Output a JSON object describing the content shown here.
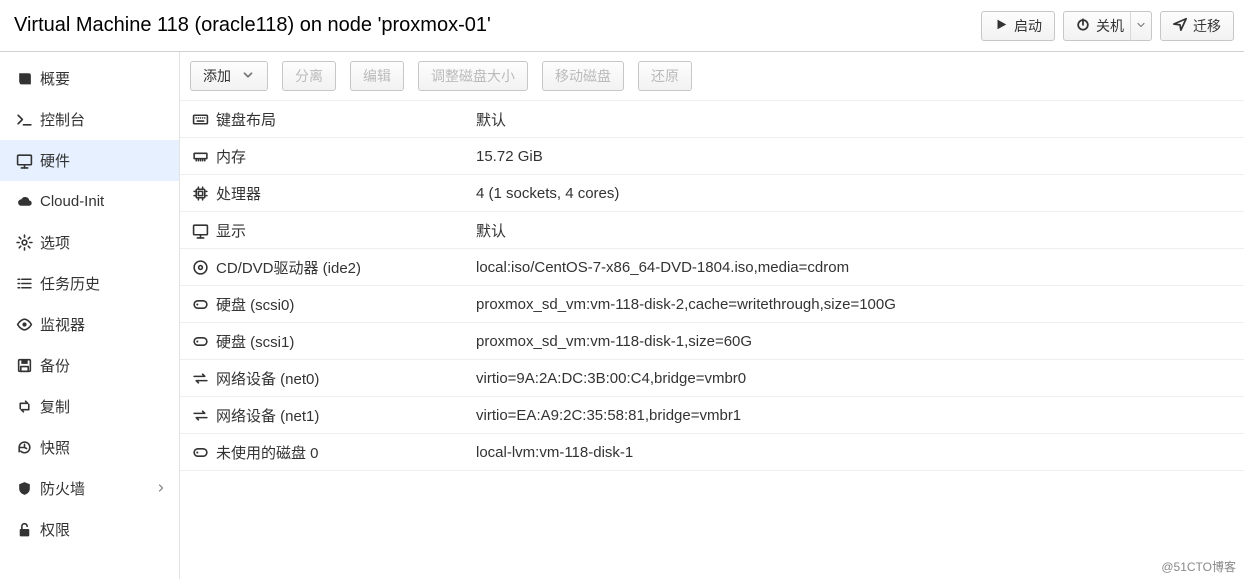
{
  "title": "Virtual Machine 118 (oracle118) on node 'proxmox-01'",
  "header_buttons": {
    "start": "启动",
    "shutdown": "关机",
    "migrate": "迁移"
  },
  "sidebar": {
    "items": [
      {
        "key": "summary",
        "label": "概要"
      },
      {
        "key": "console",
        "label": "控制台"
      },
      {
        "key": "hardware",
        "label": "硬件"
      },
      {
        "key": "cloudinit",
        "label": "Cloud-Init"
      },
      {
        "key": "options",
        "label": "选项"
      },
      {
        "key": "taskhistory",
        "label": "任务历史"
      },
      {
        "key": "monitor",
        "label": "监视器"
      },
      {
        "key": "backup",
        "label": "备份"
      },
      {
        "key": "replication",
        "label": "复制"
      },
      {
        "key": "snapshot",
        "label": "快照"
      },
      {
        "key": "firewall",
        "label": "防火墙",
        "expandable": true
      },
      {
        "key": "permissions",
        "label": "权限"
      }
    ],
    "selected": "hardware"
  },
  "toolbar": {
    "add": "添加",
    "detach": "分离",
    "edit": "编辑",
    "resize": "调整磁盘大小",
    "move": "移动磁盘",
    "revert": "还原"
  },
  "rows": [
    {
      "icon": "keyboard",
      "name": "键盘布局",
      "value": "默认"
    },
    {
      "icon": "memory",
      "name": "内存",
      "value": "15.72 GiB"
    },
    {
      "icon": "cpu",
      "name": "处理器",
      "value": "4 (1 sockets, 4 cores)"
    },
    {
      "icon": "display",
      "name": "显示",
      "value": "默认"
    },
    {
      "icon": "disc",
      "name": "CD/DVD驱动器 (ide2)",
      "value": "local:iso/CentOS-7-x86_64-DVD-1804.iso,media=cdrom"
    },
    {
      "icon": "hdd",
      "name": "硬盘 (scsi0)",
      "value": "proxmox_sd_vm:vm-118-disk-2,cache=writethrough,size=100G"
    },
    {
      "icon": "hdd",
      "name": "硬盘 (scsi1)",
      "value": "proxmox_sd_vm:vm-118-disk-1,size=60G"
    },
    {
      "icon": "net",
      "name": "网络设备 (net0)",
      "value": "virtio=9A:2A:DC:3B:00:C4,bridge=vmbr0"
    },
    {
      "icon": "net",
      "name": "网络设备 (net1)",
      "value": "virtio=EA:A9:2C:35:58:81,bridge=vmbr1"
    },
    {
      "icon": "hdd",
      "name": "未使用的磁盘 0",
      "value": "local-lvm:vm-118-disk-1"
    }
  ],
  "watermark": "@51CTO博客"
}
